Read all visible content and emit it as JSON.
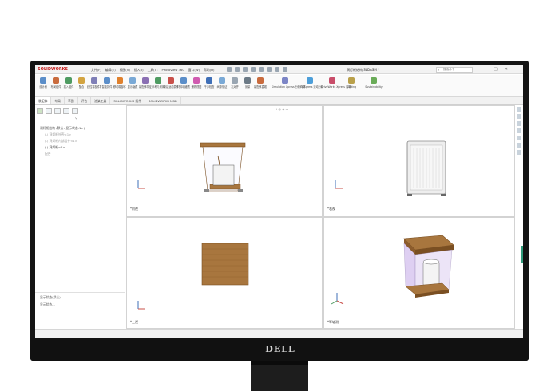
{
  "window": {
    "app_name": "SOLIDWORKS",
    "document_title": "洞灯柜结构.SLDASM *",
    "menus": [
      "文件(F)",
      "编辑(E)",
      "视图(V)",
      "插入(I)",
      "工具(T)",
      "PhotoView 360",
      "窗口(W)",
      "帮助(H)"
    ],
    "search_placeholder": "搜索命令",
    "controls": [
      "—",
      "□",
      "✕"
    ]
  },
  "ribbon": {
    "buttons": [
      "设计树",
      "布局组件",
      "插入组件",
      "配合",
      "线性零部件阵列",
      "智能扣件",
      "移动零部件",
      "显示隐藏",
      "装配体特征",
      "参考几何体",
      "新建运动算例",
      "材料明细表",
      "爆炸视图",
      "干涉检查",
      "间隙验证",
      "孔对齐",
      "测量",
      "装配体直观"
    ],
    "groups": [
      "Simulation Xpress 分析向导",
      "FloXpress 流动分析",
      "DriveWorks Xpress 向导",
      "Costing",
      "Sustainability"
    ]
  },
  "tabs": [
    "装配体",
    "布局",
    "草图",
    "评估",
    "渲染工具",
    "SOLIDWORKS 插件",
    "SOLIDWORKS MBD"
  ],
  "tree": {
    "filter_icon": "filter-icon",
    "items": [
      {
        "label": "洞灯柜结构 (默认<显示状态-1>)",
        "dim": false
      },
      {
        "label": "(-) 洞灯柜外壳<1>",
        "dim": true
      },
      {
        "label": "(-) 洞灯柜内部组件<1>",
        "dim": true
      },
      {
        "label": "(-) 洞灯柜<1>",
        "dim": false
      },
      {
        "label": "配合",
        "dim": true
      }
    ],
    "display_state": "显示状态-1",
    "bottom_label": "显示状态(默认)"
  },
  "viewports": [
    {
      "label": "*前视"
    },
    {
      "label": "*右视"
    },
    {
      "label": "*上视"
    },
    {
      "label": "*等轴测"
    }
  ],
  "colors": {
    "wood": "#a8763e",
    "wood_dark": "#7a4f22",
    "glass": "#d7c4ef",
    "accent": "#3f6fb7",
    "brand": "#c41a1a"
  },
  "monitor": {
    "brand": "DELL"
  }
}
